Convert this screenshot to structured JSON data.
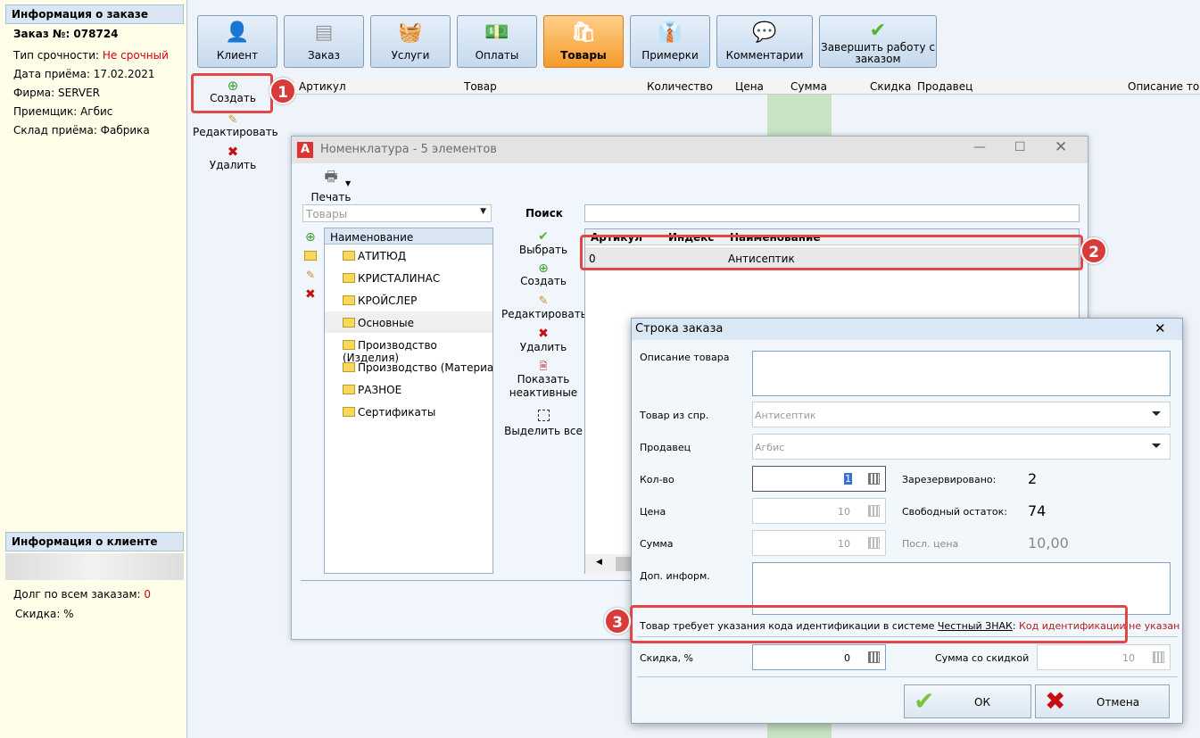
{
  "order_info": {
    "header": "Информация о заказе",
    "order_no": "Заказ №: 078724",
    "urgency_label": "Тип срочности:",
    "urgency_value": "Не срочный",
    "date": "Дата приёма: 17.02.2021",
    "firm": "Фирма: SERVER",
    "receiver": "Приемщик: Агбис",
    "warehouse": "Склад приёма: Фабрика"
  },
  "client_info": {
    "header": "Информация о клиенте",
    "debt_label": "Долг по всем заказам:",
    "debt_value": "0",
    "discount": "Скидка: %"
  },
  "toolbar": [
    {
      "label": "Клиент",
      "icon": "user-icon"
    },
    {
      "label": "Заказ",
      "icon": "document-icon"
    },
    {
      "label": "Услуги",
      "icon": "basket-icon"
    },
    {
      "label": "Оплаты",
      "icon": "money-icon"
    },
    {
      "label": "Товары",
      "icon": "bag-icon",
      "active": true
    },
    {
      "label": "Примерки",
      "icon": "suit-icon"
    },
    {
      "label": "Комментарии",
      "icon": "comment-icon"
    },
    {
      "label": "Завершить работу с заказом",
      "icon": "checkmark-icon"
    }
  ],
  "side_actions": {
    "create": "Создать",
    "edit": "Редактировать",
    "delete": "Удалить"
  },
  "grid_columns": [
    "Артикул",
    "Товар",
    "Количество",
    "Цена",
    "Сумма",
    "Скидка",
    "Продавец",
    "Описание товара"
  ],
  "nomenclature": {
    "title": "Номенклатура - 5 элементов",
    "print": "Печать",
    "category_select": "Товары",
    "tree_header": "Наименование",
    "tree_items": [
      "АТИТЮД",
      "КРИСТАЛИНАС",
      "КРОЙСЛЕР",
      "Основные",
      "Производство (Изделия)",
      "Производство (Материалы",
      "РАЗНОЕ",
      "Сертификаты"
    ],
    "search_label": "Поиск",
    "actions": {
      "select": "Выбрать",
      "create": "Создать",
      "edit": "Редактировать",
      "delete": "Удалить",
      "show_inactive": "Показать неактивные",
      "select_all": "Выделить все"
    },
    "table_headers": [
      "Артикул",
      "Индекс",
      "Наименование"
    ],
    "row": {
      "article": "0",
      "name": "Антисептик"
    }
  },
  "order_line": {
    "title": "Строка заказа",
    "description_label": "Описание товара",
    "product_label": "Товар из спр.",
    "product_value": "Антисептик",
    "seller_label": "Продавец",
    "seller_value": "Агбис",
    "qty_label": "Кол-во",
    "qty_value": "1",
    "price_label": "Цена",
    "price_value": "10",
    "sum_label": "Сумма",
    "sum_value": "10",
    "reserved_label": "Зарезервировано:",
    "reserved_value": "2",
    "free_label": "Свободный остаток:",
    "free_value": "74",
    "last_price_label": "Посл. цена",
    "last_price_value": "10,00",
    "extra_label": "Доп. информ.",
    "warning_text": "Товар требует указания кода идентификации в системе",
    "warning_link": "Честный ЗНАК",
    "warning_status": "Код идентификации не указан",
    "discount_label": "Скидка, %",
    "discount_value": "0",
    "sum_discount_label": "Сумма со скидкой",
    "sum_discount_value": "10",
    "ok": "ОК",
    "cancel": "Отмена"
  },
  "badges": [
    "1",
    "2",
    "3"
  ]
}
